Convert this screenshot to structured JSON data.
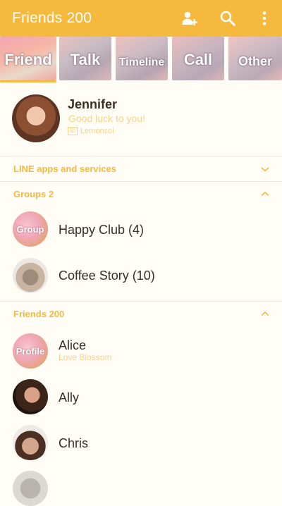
{
  "header": {
    "title": "Friends 200",
    "icons": [
      "add-friend-icon",
      "search-icon",
      "more-icon"
    ]
  },
  "tabs": [
    {
      "label": "Friend",
      "selected": true
    },
    {
      "label": "Talk"
    },
    {
      "label": "Timeline"
    },
    {
      "label": "Call"
    },
    {
      "label": "Other"
    }
  ],
  "profile": {
    "name": "Jennifer",
    "status": "Good luck to you!",
    "id_badge": "ID",
    "id_value": "Lemonsoi"
  },
  "sections": {
    "line_apps": {
      "label": "LINE apps and services"
    },
    "groups": {
      "label": "Groups 2"
    },
    "friends": {
      "label": "Friends 200"
    }
  },
  "groups": [
    {
      "name": "Happy Club (4)",
      "avatar_label": "Group"
    },
    {
      "name": "Coffee Story (10)"
    }
  ],
  "friends": [
    {
      "name": "Alice",
      "status": "Love Blossom",
      "avatar_label": "Profile"
    },
    {
      "name": "Ally"
    },
    {
      "name": "Chris"
    }
  ],
  "colors": {
    "accent": "#f5b93e",
    "background": "#fffdf5",
    "status_text": "#f8d28c",
    "name_text": "#3a2e26"
  }
}
